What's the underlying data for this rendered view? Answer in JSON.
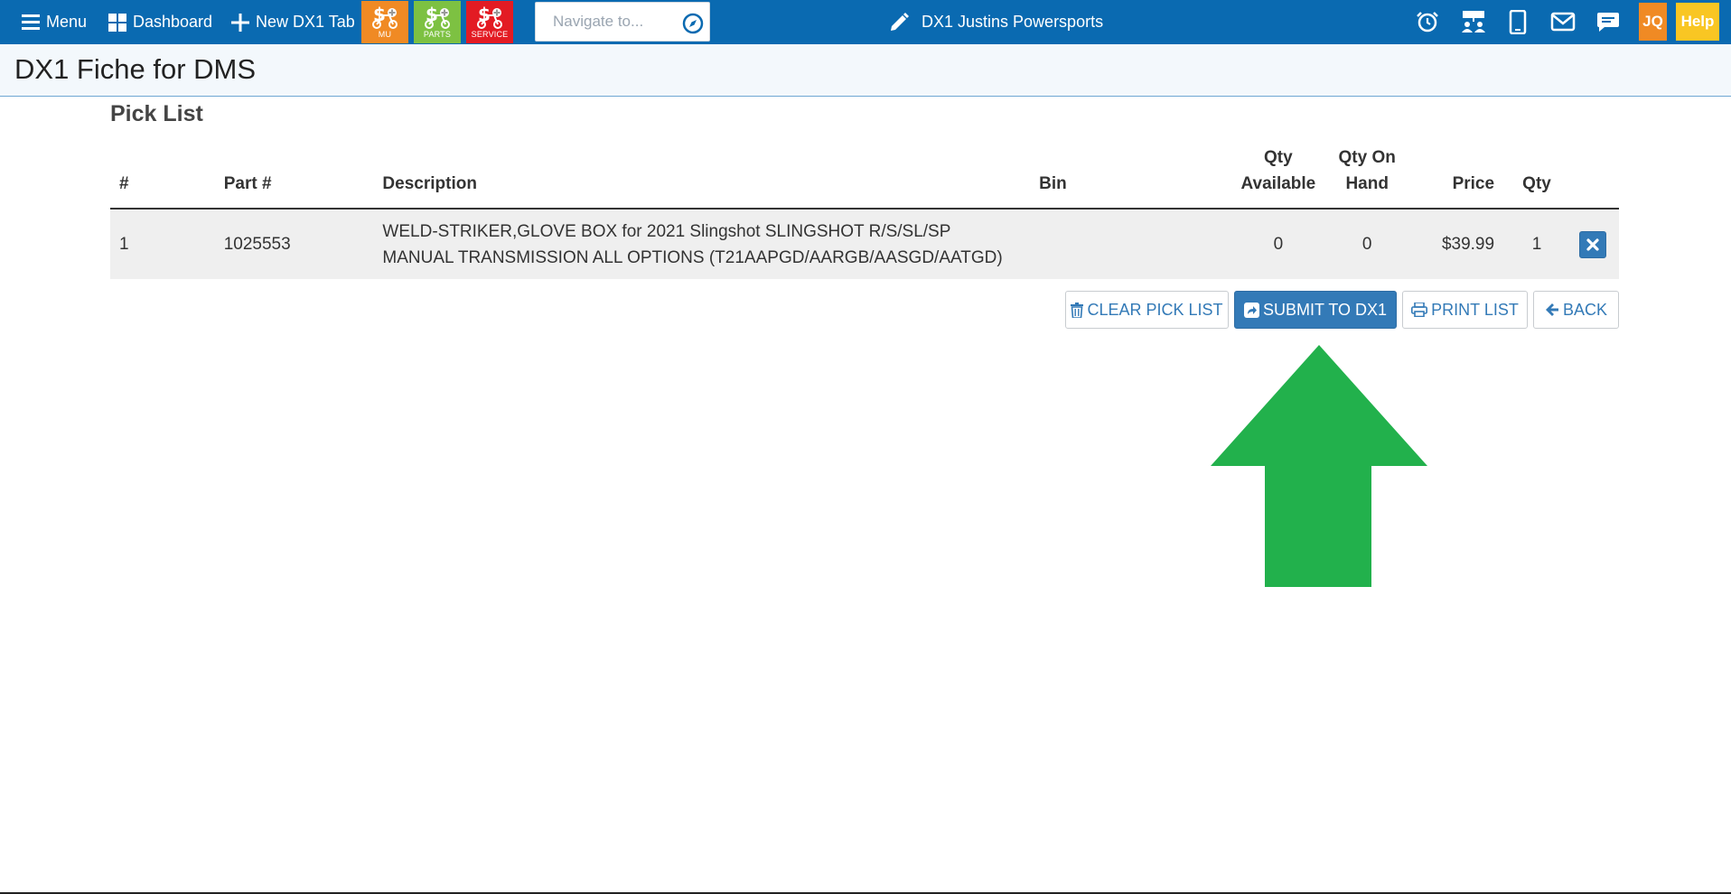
{
  "topbar": {
    "menu_label": "Menu",
    "dashboard_label": "Dashboard",
    "new_tab_label": "New DX1 Tab",
    "quick_buttons": [
      {
        "label": "MU",
        "color": "#f08a24"
      },
      {
        "label": "PARTS",
        "color": "#7dc142"
      },
      {
        "label": "SERVICE",
        "color": "#e31b23"
      }
    ],
    "search_placeholder": "Navigate to...",
    "dealer_name": "DX1 Justins Powersports",
    "user_initials": "JQ",
    "user_color": "#f08a24",
    "help_label": "Help",
    "help_color": "#f9c623",
    "bar_color": "#0a6ab1"
  },
  "page": {
    "title": "DX1 Fiche for DMS",
    "section_title": "Pick List"
  },
  "table": {
    "headers": {
      "num": "#",
      "part": "Part #",
      "description": "Description",
      "bin": "Bin",
      "qty_available_1": "Qty",
      "qty_available_2": "Available",
      "qty_on_hand_1": "Qty On",
      "qty_on_hand_2": "Hand",
      "price": "Price",
      "qty": "Qty"
    },
    "rows": [
      {
        "num": "1",
        "part": "1025553",
        "description_line1": "WELD-STRIKER,GLOVE BOX for 2021 Slingshot SLINGSHOT R/S/SL/SP",
        "description_line2": "MANUAL TRANSMISSION ALL OPTIONS (T21AAPGD/AARGB/AASGD/AATGD)",
        "bin": "",
        "qty_available": "0",
        "qty_on_hand": "0",
        "price": "$39.99",
        "qty": "1"
      }
    ]
  },
  "actions": {
    "clear_label": "CLEAR PICK LIST",
    "submit_label": "SUBMIT TO DX1",
    "print_label": "PRINT LIST",
    "back_label": "BACK"
  },
  "annotation": {
    "arrow_color": "#22b14c"
  }
}
